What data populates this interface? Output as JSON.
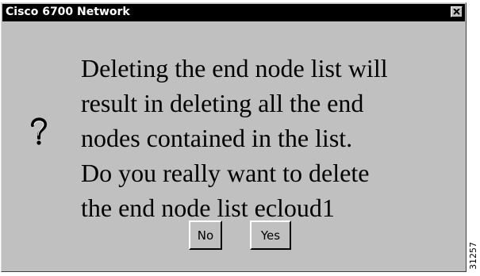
{
  "window": {
    "title": "Cisco 6700 Network"
  },
  "dialog": {
    "icon": "question-mark-icon",
    "message_lines": [
      "Deleting the end node list will",
      "result in deleting all the end",
      "nodes contained in the list.",
      "Do you really want to delete",
      "the end node list ecloud1"
    ]
  },
  "buttons": {
    "no_label": "No",
    "yes_label": "Yes"
  },
  "figure_number": "31257",
  "colors": {
    "titlebar": "#000000",
    "dialog_bg": "#c0c0c0",
    "title_text": "#ffffff"
  }
}
